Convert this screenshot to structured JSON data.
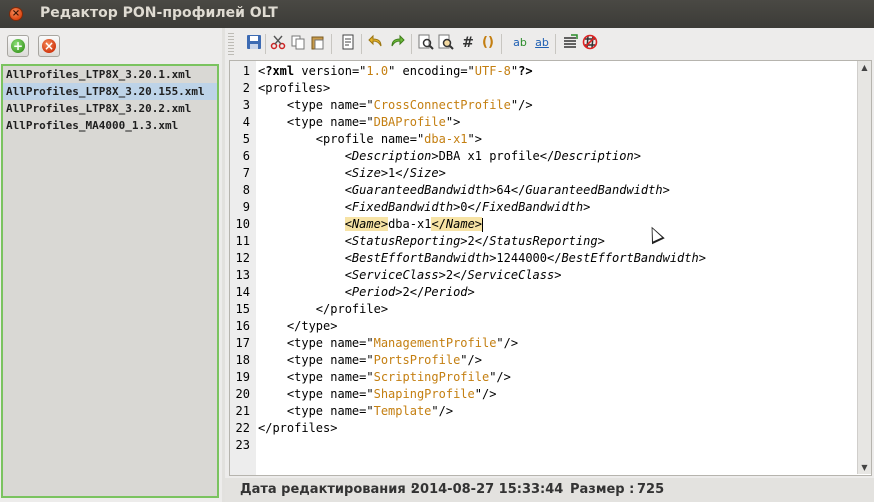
{
  "window": {
    "title": "Редактор PON-профилей OLT"
  },
  "left_toolbar": {
    "add_icon": "add-icon",
    "remove_icon": "remove-icon"
  },
  "files": [
    {
      "name": "AllProfiles_LTP8X_3.20.1.xml",
      "selected": false
    },
    {
      "name": "AllProfiles_LTP8X_3.20.155.xml",
      "selected": true
    },
    {
      "name": "AllProfiles_LTP8X_3.20.2.xml",
      "selected": false
    },
    {
      "name": "AllProfiles_MA4000_1.3.xml",
      "selected": false
    }
  ],
  "editor_toolbar": {
    "icons": [
      "save-icon",
      "cut-icon",
      "copy-icon",
      "paste-icon",
      "document-icon",
      "undo-icon",
      "redo-icon",
      "find-icon",
      "replace-icon",
      "hash-icon",
      "braces-icon",
      "spellcheck-icon",
      "spellcheck-alt-icon",
      "format-icon",
      "no-format-icon"
    ],
    "hash_glyph": "#",
    "braces_glyph": "()"
  },
  "editor": {
    "lines": [
      {
        "n": "1",
        "t": "<?xml version=\"1.0\" encoding=\"UTF-8\"?>"
      },
      {
        "n": "2",
        "t": "<profiles>"
      },
      {
        "n": "3",
        "t": "    <type name=\"CrossConnectProfile\"/>"
      },
      {
        "n": "4",
        "t": "    <type name=\"DBAProfile\">"
      },
      {
        "n": "5",
        "t": "        <profile name=\"dba-x1\">"
      },
      {
        "n": "6",
        "t": "            <Description>DBA x1 profile</Description>"
      },
      {
        "n": "7",
        "t": "            <Size>1</Size>"
      },
      {
        "n": "8",
        "t": "            <GuaranteedBandwidth>64</GuaranteedBandwidth>"
      },
      {
        "n": "9",
        "t": "            <FixedBandwidth>0</FixedBandwidth>"
      },
      {
        "n": "10",
        "t": "            <Name>dba-x1</Name>"
      },
      {
        "n": "11",
        "t": "            <StatusReporting>2</StatusReporting>"
      },
      {
        "n": "12",
        "t": "            <BestEffortBandwidth>1244000</BestEffortBandwidth>"
      },
      {
        "n": "13",
        "t": "            <ServiceClass>2</ServiceClass>"
      },
      {
        "n": "14",
        "t": "            <Period>2</Period>"
      },
      {
        "n": "15",
        "t": "        </profile>"
      },
      {
        "n": "16",
        "t": "    </type>"
      },
      {
        "n": "17",
        "t": "    <type name=\"ManagementProfile\"/>"
      },
      {
        "n": "18",
        "t": "    <type name=\"PortsProfile\"/>"
      },
      {
        "n": "19",
        "t": "    <type name=\"ScriptingProfile\"/>"
      },
      {
        "n": "20",
        "t": "    <type name=\"ShapingProfile\"/>"
      },
      {
        "n": "21",
        "t": "    <type name=\"Template\"/>"
      },
      {
        "n": "22",
        "t": "</profiles>"
      },
      {
        "n": "23",
        "t": ""
      }
    ],
    "current_line": 10
  },
  "status": {
    "edit_date_label": "Дата редактирования :",
    "edit_date_value": "2014-08-27 15:33:44",
    "size_label": "Размер :",
    "size_value": "725"
  }
}
